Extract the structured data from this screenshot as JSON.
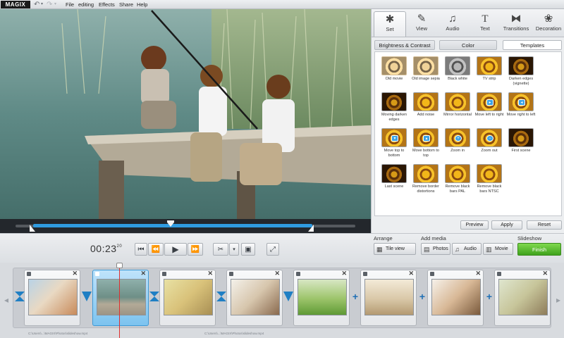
{
  "app": {
    "logo": "MAGIX"
  },
  "menu": [
    "File",
    "editing",
    "Effects",
    "Share",
    "Help"
  ],
  "toolbar_icons": [
    "undo-icon",
    "redo-icon"
  ],
  "right_tabs": [
    {
      "label": "Set",
      "icon": "set-icon",
      "active": true
    },
    {
      "label": "View",
      "icon": "view-icon"
    },
    {
      "label": "Audio",
      "icon": "audio-icon"
    },
    {
      "label": "Text",
      "icon": "text-icon"
    },
    {
      "label": "Transitions",
      "icon": "transitions-icon"
    },
    {
      "label": "Decoration",
      "icon": "decoration-icon"
    }
  ],
  "sub_tabs": [
    {
      "label": "Brightness & Contrast"
    },
    {
      "label": "Color"
    },
    {
      "label": "Templates",
      "active": true
    }
  ],
  "templates": [
    "Old movie",
    "Old image sepia",
    "Black white",
    "TV strip",
    "Darken edges (vignette)",
    "Moving darken edges",
    "Add noise",
    "Mirror horizontal",
    "Move left to right",
    "Move right to left",
    "Move top to bottom",
    "Move bottom to top",
    "Zoom in",
    "Zoom out",
    "First scene",
    "Last scene",
    "Remove border distortions",
    "Remove black bars PAL",
    "Remove black bars NTSC"
  ],
  "panel_buttons": {
    "preview": "Preview",
    "apply": "Apply",
    "reset": "Reset"
  },
  "playback": {
    "timecode": "00:23",
    "frames": "20"
  },
  "arrange": {
    "label": "Arrange",
    "tile_view": "Tile view"
  },
  "add_media": {
    "label": "Add media",
    "photos": "Photos",
    "audio": "Audio",
    "movie": "Movie"
  },
  "slideshow": {
    "label": "Slideshow",
    "finish": "Finish"
  },
  "timeline": {
    "clips": [
      "family",
      "pier",
      "girls",
      "couple",
      "lawn",
      "beach",
      "sunglasses",
      "camera"
    ],
    "selected_clip": 1,
    "transitions": [
      "bowtie",
      "blue",
      "bowtie",
      "bowtie",
      "blue",
      "plus",
      "plus",
      "plus"
    ],
    "captions": [
      "C:\\Users\\...\\MAGIX\\Photos\\slideshow.mp4",
      "C:\\Users\\...\\MAGIX\\Photos\\slideshow.mp4"
    ]
  },
  "colors": {
    "accent": "#2f9be0",
    "finish": "#4caf22",
    "playhead": "#e03030"
  }
}
